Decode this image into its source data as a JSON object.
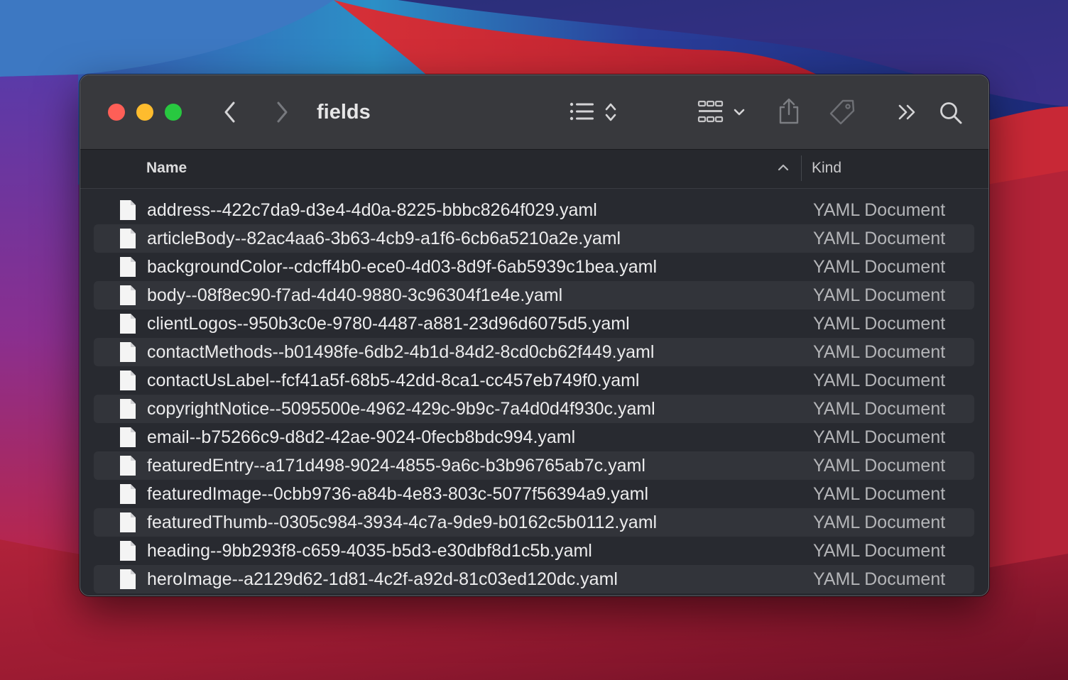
{
  "window": {
    "title": "fields"
  },
  "toolbar": {
    "icons": [
      "back-chevron-icon",
      "forward-chevron-icon",
      "list-view-icon",
      "sort-updown-icon",
      "icon-grid-icon",
      "chevron-down-icon",
      "share-icon",
      "tag-icon",
      "more-icon",
      "search-icon"
    ]
  },
  "columns": {
    "name": "Name",
    "kind": "Kind",
    "sort_direction": "ascending"
  },
  "files": [
    {
      "name": "address--422c7da9-d3e4-4d0a-8225-bbbc8264f029.yaml",
      "kind": "YAML Document"
    },
    {
      "name": "articleBody--82ac4aa6-3b63-4cb9-a1f6-6cb6a5210a2e.yaml",
      "kind": "YAML Document"
    },
    {
      "name": "backgroundColor--cdcff4b0-ece0-4d03-8d9f-6ab5939c1bea.yaml",
      "kind": "YAML Document"
    },
    {
      "name": "body--08f8ec90-f7ad-4d40-9880-3c96304f1e4e.yaml",
      "kind": "YAML Document"
    },
    {
      "name": "clientLogos--950b3c0e-9780-4487-a881-23d96d6075d5.yaml",
      "kind": "YAML Document"
    },
    {
      "name": "contactMethods--b01498fe-6db2-4b1d-84d2-8cd0cb62f449.yaml",
      "kind": "YAML Document"
    },
    {
      "name": "contactUsLabel--fcf41a5f-68b5-42dd-8ca1-cc457eb749f0.yaml",
      "kind": "YAML Document"
    },
    {
      "name": "copyrightNotice--5095500e-4962-429c-9b9c-7a4d0d4f930c.yaml",
      "kind": "YAML Document"
    },
    {
      "name": "email--b75266c9-d8d2-42ae-9024-0fecb8bdc994.yaml",
      "kind": "YAML Document"
    },
    {
      "name": "featuredEntry--a171d498-9024-4855-9a6c-b3b96765ab7c.yaml",
      "kind": "YAML Document"
    },
    {
      "name": "featuredImage--0cbb9736-a84b-4e83-803c-5077f56394a9.yaml",
      "kind": "YAML Document"
    },
    {
      "name": "featuredThumb--0305c984-3934-4c7a-9de9-b0162c5b0112.yaml",
      "kind": "YAML Document"
    },
    {
      "name": "heading--9bb293f8-c659-4035-b5d3-e30dbf8d1c5b.yaml",
      "kind": "YAML Document"
    },
    {
      "name": "heroImage--a2129d62-1d81-4c2f-a92d-81c03ed120dc.yaml",
      "kind": "YAML Document"
    }
  ]
}
